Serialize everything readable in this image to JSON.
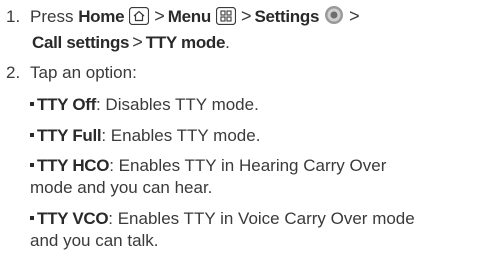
{
  "step1": {
    "number": "1.",
    "press": "Press",
    "home": "Home",
    "menu": "Menu",
    "settings": "Settings",
    "call_settings": "Call settings",
    "tty_mode": "TTY mode",
    "separator": ">",
    "end": ".",
    "icons": [
      "home-icon",
      "menu-icon",
      "settings-icon"
    ]
  },
  "step2": {
    "number": "2.",
    "text": "Tap an option:"
  },
  "options": [
    {
      "name": "TTY Off",
      "desc": ": Disables TTY mode.",
      "desc2": ""
    },
    {
      "name": "TTY Full",
      "desc": ": Enables TTY mode.",
      "desc2": ""
    },
    {
      "name": "TTY HCO",
      "desc": ": Enables TTY in Hearing Carry Over",
      "desc2": "mode and you can hear."
    },
    {
      "name": "TTY VCO",
      "desc": ": Enables TTY in Voice Carry Over mode",
      "desc2": "and you can talk."
    }
  ]
}
